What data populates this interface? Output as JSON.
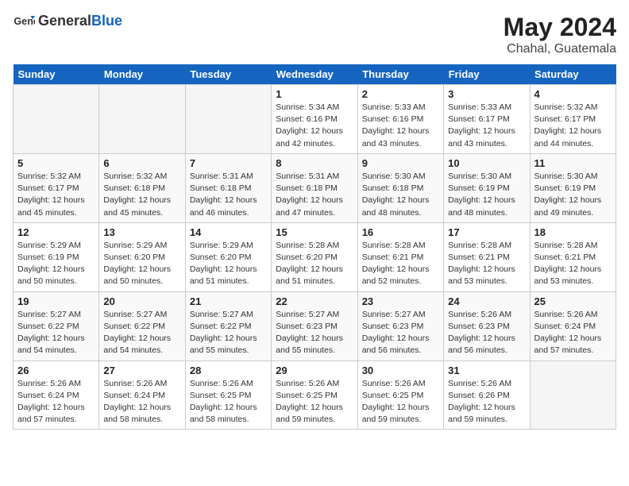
{
  "header": {
    "logo_general": "General",
    "logo_blue": "Blue",
    "month_year": "May 2024",
    "location": "Chahal, Guatemala"
  },
  "weekdays": [
    "Sunday",
    "Monday",
    "Tuesday",
    "Wednesday",
    "Thursday",
    "Friday",
    "Saturday"
  ],
  "weeks": [
    [
      {
        "day": "",
        "empty": true
      },
      {
        "day": "",
        "empty": true
      },
      {
        "day": "",
        "empty": true
      },
      {
        "day": "1",
        "sunrise": "5:34 AM",
        "sunset": "6:16 PM",
        "daylight": "12 hours and 42 minutes."
      },
      {
        "day": "2",
        "sunrise": "5:33 AM",
        "sunset": "6:16 PM",
        "daylight": "12 hours and 43 minutes."
      },
      {
        "day": "3",
        "sunrise": "5:33 AM",
        "sunset": "6:17 PM",
        "daylight": "12 hours and 43 minutes."
      },
      {
        "day": "4",
        "sunrise": "5:32 AM",
        "sunset": "6:17 PM",
        "daylight": "12 hours and 44 minutes."
      }
    ],
    [
      {
        "day": "5",
        "sunrise": "5:32 AM",
        "sunset": "6:17 PM",
        "daylight": "12 hours and 45 minutes."
      },
      {
        "day": "6",
        "sunrise": "5:32 AM",
        "sunset": "6:18 PM",
        "daylight": "12 hours and 45 minutes."
      },
      {
        "day": "7",
        "sunrise": "5:31 AM",
        "sunset": "6:18 PM",
        "daylight": "12 hours and 46 minutes."
      },
      {
        "day": "8",
        "sunrise": "5:31 AM",
        "sunset": "6:18 PM",
        "daylight": "12 hours and 47 minutes."
      },
      {
        "day": "9",
        "sunrise": "5:30 AM",
        "sunset": "6:18 PM",
        "daylight": "12 hours and 48 minutes."
      },
      {
        "day": "10",
        "sunrise": "5:30 AM",
        "sunset": "6:19 PM",
        "daylight": "12 hours and 48 minutes."
      },
      {
        "day": "11",
        "sunrise": "5:30 AM",
        "sunset": "6:19 PM",
        "daylight": "12 hours and 49 minutes."
      }
    ],
    [
      {
        "day": "12",
        "sunrise": "5:29 AM",
        "sunset": "6:19 PM",
        "daylight": "12 hours and 50 minutes."
      },
      {
        "day": "13",
        "sunrise": "5:29 AM",
        "sunset": "6:20 PM",
        "daylight": "12 hours and 50 minutes."
      },
      {
        "day": "14",
        "sunrise": "5:29 AM",
        "sunset": "6:20 PM",
        "daylight": "12 hours and 51 minutes."
      },
      {
        "day": "15",
        "sunrise": "5:28 AM",
        "sunset": "6:20 PM",
        "daylight": "12 hours and 51 minutes."
      },
      {
        "day": "16",
        "sunrise": "5:28 AM",
        "sunset": "6:21 PM",
        "daylight": "12 hours and 52 minutes."
      },
      {
        "day": "17",
        "sunrise": "5:28 AM",
        "sunset": "6:21 PM",
        "daylight": "12 hours and 53 minutes."
      },
      {
        "day": "18",
        "sunrise": "5:28 AM",
        "sunset": "6:21 PM",
        "daylight": "12 hours and 53 minutes."
      }
    ],
    [
      {
        "day": "19",
        "sunrise": "5:27 AM",
        "sunset": "6:22 PM",
        "daylight": "12 hours and 54 minutes."
      },
      {
        "day": "20",
        "sunrise": "5:27 AM",
        "sunset": "6:22 PM",
        "daylight": "12 hours and 54 minutes."
      },
      {
        "day": "21",
        "sunrise": "5:27 AM",
        "sunset": "6:22 PM",
        "daylight": "12 hours and 55 minutes."
      },
      {
        "day": "22",
        "sunrise": "5:27 AM",
        "sunset": "6:23 PM",
        "daylight": "12 hours and 55 minutes."
      },
      {
        "day": "23",
        "sunrise": "5:27 AM",
        "sunset": "6:23 PM",
        "daylight": "12 hours and 56 minutes."
      },
      {
        "day": "24",
        "sunrise": "5:26 AM",
        "sunset": "6:23 PM",
        "daylight": "12 hours and 56 minutes."
      },
      {
        "day": "25",
        "sunrise": "5:26 AM",
        "sunset": "6:24 PM",
        "daylight": "12 hours and 57 minutes."
      }
    ],
    [
      {
        "day": "26",
        "sunrise": "5:26 AM",
        "sunset": "6:24 PM",
        "daylight": "12 hours and 57 minutes."
      },
      {
        "day": "27",
        "sunrise": "5:26 AM",
        "sunset": "6:24 PM",
        "daylight": "12 hours and 58 minutes."
      },
      {
        "day": "28",
        "sunrise": "5:26 AM",
        "sunset": "6:25 PM",
        "daylight": "12 hours and 58 minutes."
      },
      {
        "day": "29",
        "sunrise": "5:26 AM",
        "sunset": "6:25 PM",
        "daylight": "12 hours and 59 minutes."
      },
      {
        "day": "30",
        "sunrise": "5:26 AM",
        "sunset": "6:25 PM",
        "daylight": "12 hours and 59 minutes."
      },
      {
        "day": "31",
        "sunrise": "5:26 AM",
        "sunset": "6:26 PM",
        "daylight": "12 hours and 59 minutes."
      },
      {
        "day": "",
        "empty": true
      }
    ]
  ]
}
